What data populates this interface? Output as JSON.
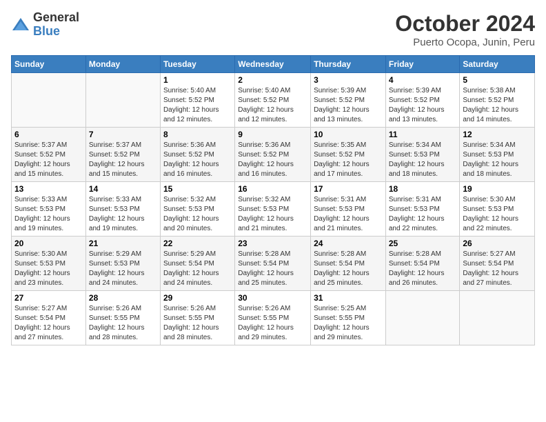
{
  "header": {
    "logo_general": "General",
    "logo_blue": "Blue",
    "month_title": "October 2024",
    "location": "Puerto Ocopa, Junin, Peru"
  },
  "days_of_week": [
    "Sunday",
    "Monday",
    "Tuesday",
    "Wednesday",
    "Thursday",
    "Friday",
    "Saturday"
  ],
  "weeks": [
    [
      {
        "day": "",
        "detail": ""
      },
      {
        "day": "",
        "detail": ""
      },
      {
        "day": "1",
        "detail": "Sunrise: 5:40 AM\nSunset: 5:52 PM\nDaylight: 12 hours\nand 12 minutes."
      },
      {
        "day": "2",
        "detail": "Sunrise: 5:40 AM\nSunset: 5:52 PM\nDaylight: 12 hours\nand 12 minutes."
      },
      {
        "day": "3",
        "detail": "Sunrise: 5:39 AM\nSunset: 5:52 PM\nDaylight: 12 hours\nand 13 minutes."
      },
      {
        "day": "4",
        "detail": "Sunrise: 5:39 AM\nSunset: 5:52 PM\nDaylight: 12 hours\nand 13 minutes."
      },
      {
        "day": "5",
        "detail": "Sunrise: 5:38 AM\nSunset: 5:52 PM\nDaylight: 12 hours\nand 14 minutes."
      }
    ],
    [
      {
        "day": "6",
        "detail": "Sunrise: 5:37 AM\nSunset: 5:52 PM\nDaylight: 12 hours\nand 15 minutes."
      },
      {
        "day": "7",
        "detail": "Sunrise: 5:37 AM\nSunset: 5:52 PM\nDaylight: 12 hours\nand 15 minutes."
      },
      {
        "day": "8",
        "detail": "Sunrise: 5:36 AM\nSunset: 5:52 PM\nDaylight: 12 hours\nand 16 minutes."
      },
      {
        "day": "9",
        "detail": "Sunrise: 5:36 AM\nSunset: 5:52 PM\nDaylight: 12 hours\nand 16 minutes."
      },
      {
        "day": "10",
        "detail": "Sunrise: 5:35 AM\nSunset: 5:52 PM\nDaylight: 12 hours\nand 17 minutes."
      },
      {
        "day": "11",
        "detail": "Sunrise: 5:34 AM\nSunset: 5:53 PM\nDaylight: 12 hours\nand 18 minutes."
      },
      {
        "day": "12",
        "detail": "Sunrise: 5:34 AM\nSunset: 5:53 PM\nDaylight: 12 hours\nand 18 minutes."
      }
    ],
    [
      {
        "day": "13",
        "detail": "Sunrise: 5:33 AM\nSunset: 5:53 PM\nDaylight: 12 hours\nand 19 minutes."
      },
      {
        "day": "14",
        "detail": "Sunrise: 5:33 AM\nSunset: 5:53 PM\nDaylight: 12 hours\nand 19 minutes."
      },
      {
        "day": "15",
        "detail": "Sunrise: 5:32 AM\nSunset: 5:53 PM\nDaylight: 12 hours\nand 20 minutes."
      },
      {
        "day": "16",
        "detail": "Sunrise: 5:32 AM\nSunset: 5:53 PM\nDaylight: 12 hours\nand 21 minutes."
      },
      {
        "day": "17",
        "detail": "Sunrise: 5:31 AM\nSunset: 5:53 PM\nDaylight: 12 hours\nand 21 minutes."
      },
      {
        "day": "18",
        "detail": "Sunrise: 5:31 AM\nSunset: 5:53 PM\nDaylight: 12 hours\nand 22 minutes."
      },
      {
        "day": "19",
        "detail": "Sunrise: 5:30 AM\nSunset: 5:53 PM\nDaylight: 12 hours\nand 22 minutes."
      }
    ],
    [
      {
        "day": "20",
        "detail": "Sunrise: 5:30 AM\nSunset: 5:53 PM\nDaylight: 12 hours\nand 23 minutes."
      },
      {
        "day": "21",
        "detail": "Sunrise: 5:29 AM\nSunset: 5:53 PM\nDaylight: 12 hours\nand 24 minutes."
      },
      {
        "day": "22",
        "detail": "Sunrise: 5:29 AM\nSunset: 5:54 PM\nDaylight: 12 hours\nand 24 minutes."
      },
      {
        "day": "23",
        "detail": "Sunrise: 5:28 AM\nSunset: 5:54 PM\nDaylight: 12 hours\nand 25 minutes."
      },
      {
        "day": "24",
        "detail": "Sunrise: 5:28 AM\nSunset: 5:54 PM\nDaylight: 12 hours\nand 25 minutes."
      },
      {
        "day": "25",
        "detail": "Sunrise: 5:28 AM\nSunset: 5:54 PM\nDaylight: 12 hours\nand 26 minutes."
      },
      {
        "day": "26",
        "detail": "Sunrise: 5:27 AM\nSunset: 5:54 PM\nDaylight: 12 hours\nand 27 minutes."
      }
    ],
    [
      {
        "day": "27",
        "detail": "Sunrise: 5:27 AM\nSunset: 5:54 PM\nDaylight: 12 hours\nand 27 minutes."
      },
      {
        "day": "28",
        "detail": "Sunrise: 5:26 AM\nSunset: 5:55 PM\nDaylight: 12 hours\nand 28 minutes."
      },
      {
        "day": "29",
        "detail": "Sunrise: 5:26 AM\nSunset: 5:55 PM\nDaylight: 12 hours\nand 28 minutes."
      },
      {
        "day": "30",
        "detail": "Sunrise: 5:26 AM\nSunset: 5:55 PM\nDaylight: 12 hours\nand 29 minutes."
      },
      {
        "day": "31",
        "detail": "Sunrise: 5:25 AM\nSunset: 5:55 PM\nDaylight: 12 hours\nand 29 minutes."
      },
      {
        "day": "",
        "detail": ""
      },
      {
        "day": "",
        "detail": ""
      }
    ]
  ]
}
